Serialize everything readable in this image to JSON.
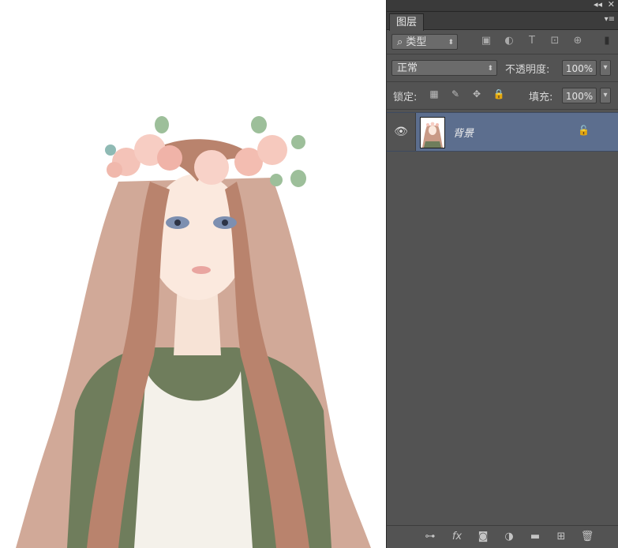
{
  "panel": {
    "collapse_glyph": "◂◂",
    "close_glyph": "✕",
    "tab_title": "图层",
    "menu_glyph": "▾≡"
  },
  "filter": {
    "search_glyph": "⌕",
    "kind_label": "类型",
    "arrow_glyph": "⬍",
    "icons": [
      "image-filter-icon",
      "adjustment-filter-icon",
      "type-filter-icon",
      "shape-filter-icon",
      "smart-object-filter-icon"
    ],
    "icon_glyphs": [
      "▣",
      "◐",
      "T",
      "⊡",
      "⊕"
    ],
    "toggle_glyph": "▮"
  },
  "blend": {
    "mode": "正常",
    "arrow_glyph": "⬍",
    "opacity_label": "不透明度:",
    "opacity_value": "100%",
    "spin_glyph": "▾"
  },
  "lock": {
    "label": "锁定:",
    "icon_glyphs": [
      "▦",
      "✎",
      "✥",
      "🔒"
    ],
    "fill_label": "填充:",
    "fill_value": "100%",
    "spin_glyph": "▾"
  },
  "layers": [
    {
      "name": "背景",
      "visible_glyph": "👁",
      "lock_glyph": "🔓"
    }
  ],
  "footer": {
    "icons": [
      "link-layers-icon",
      "fx-icon",
      "add-mask-icon",
      "adjustment-layer-icon",
      "new-group-icon",
      "new-layer-icon",
      "trash-icon"
    ],
    "icon_glyphs": [
      "⊶",
      "fx",
      "◙",
      "◑",
      "▬",
      "⊞",
      "🗑"
    ]
  },
  "colors": {
    "panel_bg": "#535353",
    "selected_layer": "#5c6e8e"
  }
}
